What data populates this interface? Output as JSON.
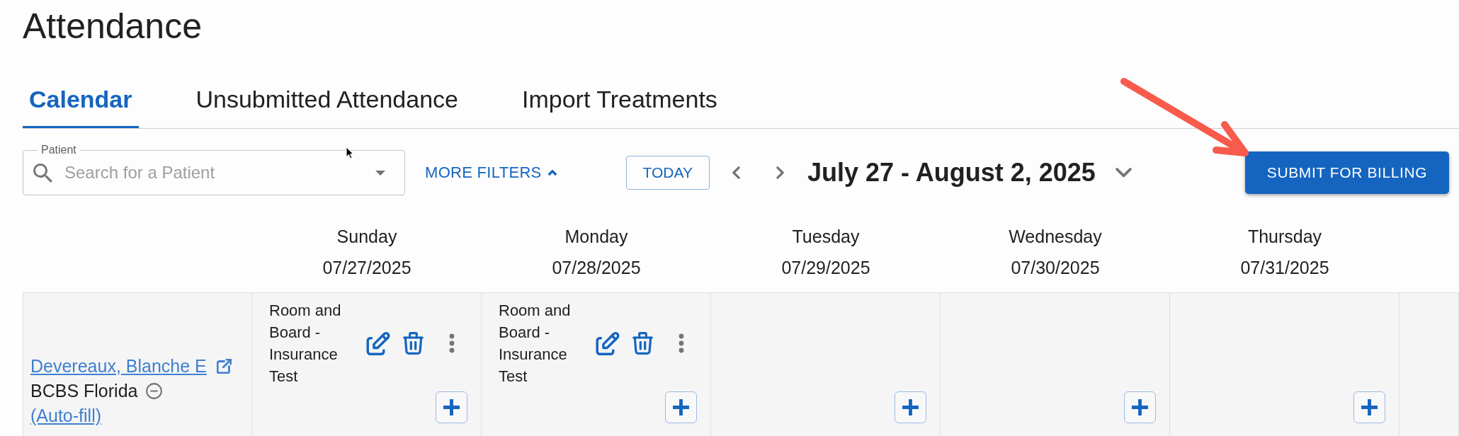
{
  "page": {
    "title": "Attendance"
  },
  "tabs": [
    {
      "label": "Calendar",
      "selected": true
    },
    {
      "label": "Unsubmitted Attendance",
      "selected": false
    },
    {
      "label": "Import Treatments",
      "selected": false
    }
  ],
  "toolbar": {
    "patient_field": {
      "label": "Patient",
      "placeholder": "Search for a Patient"
    },
    "more_filters": {
      "label": "MORE FILTERS",
      "expanded": true
    },
    "today_button": "TODAY",
    "date_range": "July 27 - August 2, 2025",
    "submit_button": "SUBMIT FOR BILLING"
  },
  "calendar": {
    "days": [
      {
        "name": "Sunday",
        "date": "07/27/2025"
      },
      {
        "name": "Monday",
        "date": "07/28/2025"
      },
      {
        "name": "Tuesday",
        "date": "07/29/2025"
      },
      {
        "name": "Wednesday",
        "date": "07/30/2025"
      },
      {
        "name": "Thursday",
        "date": "07/31/2025"
      }
    ],
    "rows": [
      {
        "patient": "Devereaux, Blanche E",
        "payer": "BCBS Florida",
        "autofill": "(Auto-fill)",
        "cells": [
          {
            "add_button": true,
            "entries": [
              {
                "title": "Room and Board - Insurance Test"
              }
            ]
          },
          {
            "add_button": true,
            "entries": [
              {
                "title": "Room and Board - Insurance Test"
              }
            ]
          },
          {
            "add_button": true
          },
          {
            "add_button": true
          },
          {
            "add_button": true
          }
        ]
      }
    ]
  }
}
